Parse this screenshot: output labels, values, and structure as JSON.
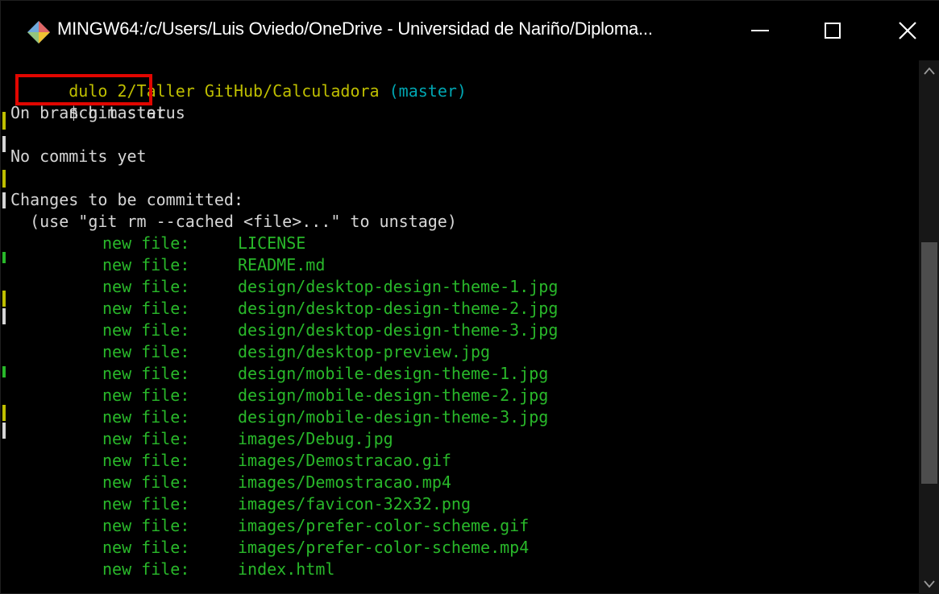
{
  "window": {
    "title": "MINGW64:/c/Users/Luis Oviedo/OneDrive - Universidad de Nariño/Diploma...",
    "icon": "git-bash-diamond-icon",
    "controls": {
      "minimize": "minimize",
      "maximize": "maximize",
      "close": "close"
    }
  },
  "colors": {
    "background": "#000000",
    "path": "#bfbf00",
    "branch": "#00a6b2",
    "staged": "#29b82a",
    "text": "#d6d6d6",
    "highlight": "#e10600"
  },
  "terminal": {
    "prompt_path": "dulo 2/Taller GitHub/Calculadora",
    "prompt_branch": "(master)",
    "prompt_symbol": "$",
    "command": "git status",
    "branch_line": "On branch master",
    "commits_line": "No commits yet",
    "changes_header": "Changes to be committed:",
    "hint": "  (use \"git rm --cached <file>...\" to unstage)",
    "staged_label": "new file:",
    "staged_files": [
      "LICENSE",
      "README.md",
      "design/desktop-design-theme-1.jpg",
      "design/desktop-design-theme-2.jpg",
      "design/desktop-design-theme-3.jpg",
      "design/desktop-preview.jpg",
      "design/mobile-design-theme-1.jpg",
      "design/mobile-design-theme-2.jpg",
      "design/mobile-design-theme-3.jpg",
      "images/Debug.jpg",
      "images/Demostracao.gif",
      "images/Demostracao.mp4",
      "images/favicon-32x32.png",
      "images/prefer-color-scheme.gif",
      "images/prefer-color-scheme.mp4",
      "index.html"
    ]
  },
  "scrollbar": {
    "up_icon": "scroll-up-arrow-icon",
    "down_icon": "scroll-down-arrow-icon"
  }
}
